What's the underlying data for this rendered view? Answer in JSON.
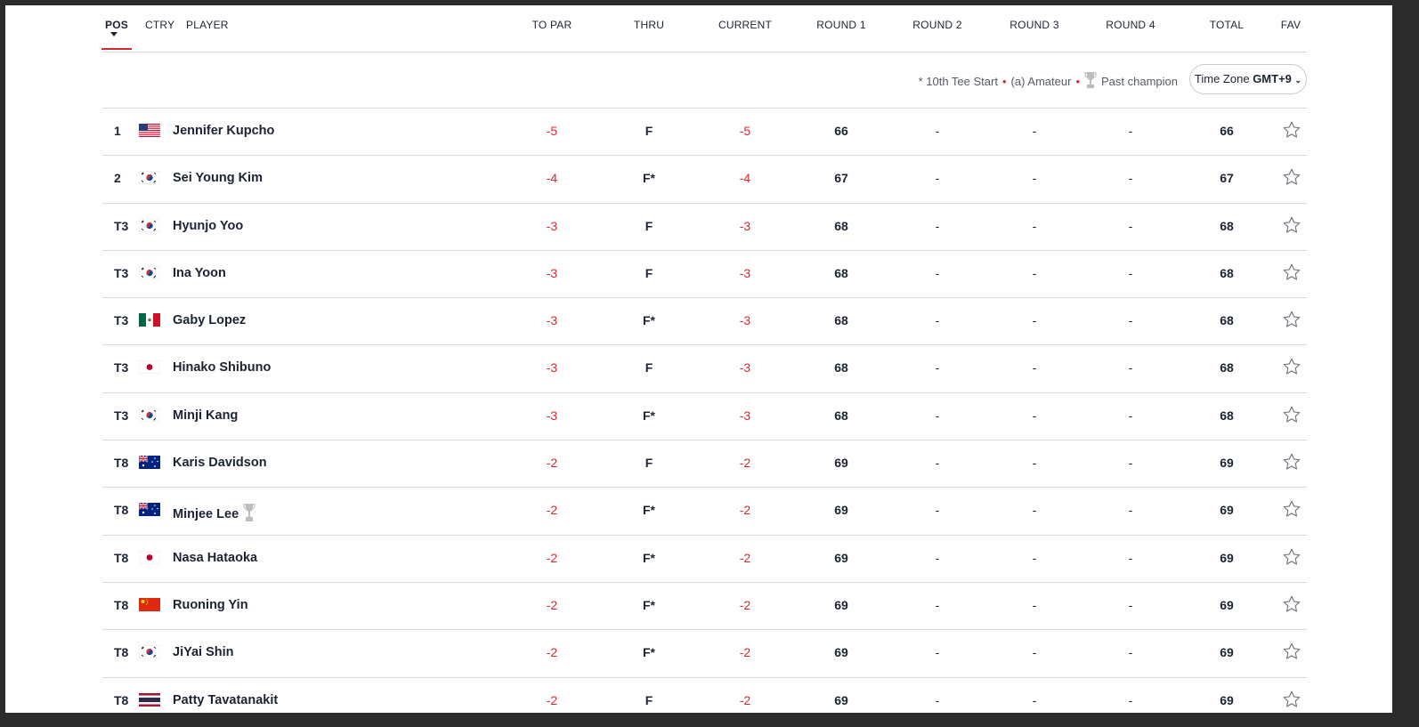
{
  "headers": {
    "pos": "POS",
    "ctry": "CTRY",
    "player": "PLAYER",
    "to_par": "TO PAR",
    "thru": "THRU",
    "current": "CURRENT",
    "round1": "ROUND 1",
    "round2": "ROUND 2",
    "round3": "ROUND 3",
    "round4": "ROUND 4",
    "total": "TOTAL",
    "fav": "FAV"
  },
  "legend": {
    "tee_start": "* 10th Tee Start",
    "amateur": "(a) Amateur",
    "past_champion": "Past champion"
  },
  "timezone": {
    "label": "Time Zone",
    "value": "GMT+9"
  },
  "colors": {
    "accent": "#d7282f",
    "text": "#1b2433",
    "border": "#d8d8d8"
  },
  "rows": [
    {
      "pos": "1",
      "flag": "us",
      "player": "Jennifer Kupcho",
      "to_par": "-5",
      "thru": "F",
      "current": "-5",
      "r1": "66",
      "r2": "-",
      "r3": "-",
      "r4": "-",
      "total": "66",
      "champion": false
    },
    {
      "pos": "2",
      "flag": "kr",
      "player": "Sei Young Kim",
      "to_par": "-4",
      "thru": "F*",
      "current": "-4",
      "r1": "67",
      "r2": "-",
      "r3": "-",
      "r4": "-",
      "total": "67",
      "champion": false
    },
    {
      "pos": "T3",
      "flag": "kr",
      "player": "Hyunjo Yoo",
      "to_par": "-3",
      "thru": "F",
      "current": "-3",
      "r1": "68",
      "r2": "-",
      "r3": "-",
      "r4": "-",
      "total": "68",
      "champion": false
    },
    {
      "pos": "T3",
      "flag": "kr",
      "player": "Ina Yoon",
      "to_par": "-3",
      "thru": "F",
      "current": "-3",
      "r1": "68",
      "r2": "-",
      "r3": "-",
      "r4": "-",
      "total": "68",
      "champion": false
    },
    {
      "pos": "T3",
      "flag": "mx",
      "player": "Gaby Lopez",
      "to_par": "-3",
      "thru": "F*",
      "current": "-3",
      "r1": "68",
      "r2": "-",
      "r3": "-",
      "r4": "-",
      "total": "68",
      "champion": false
    },
    {
      "pos": "T3",
      "flag": "jp",
      "player": "Hinako Shibuno",
      "to_par": "-3",
      "thru": "F",
      "current": "-3",
      "r1": "68",
      "r2": "-",
      "r3": "-",
      "r4": "-",
      "total": "68",
      "champion": false
    },
    {
      "pos": "T3",
      "flag": "kr",
      "player": "Minji Kang",
      "to_par": "-3",
      "thru": "F*",
      "current": "-3",
      "r1": "68",
      "r2": "-",
      "r3": "-",
      "r4": "-",
      "total": "68",
      "champion": false
    },
    {
      "pos": "T8",
      "flag": "au",
      "player": "Karis Davidson",
      "to_par": "-2",
      "thru": "F",
      "current": "-2",
      "r1": "69",
      "r2": "-",
      "r3": "-",
      "r4": "-",
      "total": "69",
      "champion": false
    },
    {
      "pos": "T8",
      "flag": "au",
      "player": "Minjee Lee",
      "to_par": "-2",
      "thru": "F*",
      "current": "-2",
      "r1": "69",
      "r2": "-",
      "r3": "-",
      "r4": "-",
      "total": "69",
      "champion": true
    },
    {
      "pos": "T8",
      "flag": "jp",
      "player": "Nasa Hataoka",
      "to_par": "-2",
      "thru": "F*",
      "current": "-2",
      "r1": "69",
      "r2": "-",
      "r3": "-",
      "r4": "-",
      "total": "69",
      "champion": false
    },
    {
      "pos": "T8",
      "flag": "cn",
      "player": "Ruoning Yin",
      "to_par": "-2",
      "thru": "F*",
      "current": "-2",
      "r1": "69",
      "r2": "-",
      "r3": "-",
      "r4": "-",
      "total": "69",
      "champion": false
    },
    {
      "pos": "T8",
      "flag": "kr",
      "player": "JiYai Shin",
      "to_par": "-2",
      "thru": "F*",
      "current": "-2",
      "r1": "69",
      "r2": "-",
      "r3": "-",
      "r4": "-",
      "total": "69",
      "champion": false
    },
    {
      "pos": "T8",
      "flag": "th",
      "player": "Patty Tavatanakit",
      "to_par": "-2",
      "thru": "F",
      "current": "-2",
      "r1": "69",
      "r2": "-",
      "r3": "-",
      "r4": "-",
      "total": "69",
      "champion": false
    }
  ]
}
